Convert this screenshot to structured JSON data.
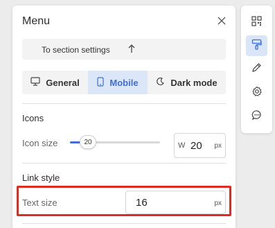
{
  "panel": {
    "title": "Menu",
    "close_icon": "close-icon",
    "section_link": {
      "label": "To section settings",
      "icon": "arrow-up-icon"
    },
    "tabs": [
      {
        "label": "General",
        "icon": "monitor-icon",
        "active": false
      },
      {
        "label": "Mobile",
        "icon": "phone-icon",
        "active": true
      },
      {
        "label": "Dark mode",
        "icon": "moon-icon",
        "active": false
      }
    ],
    "icons_section": {
      "title": "Icons",
      "icon_size": {
        "label": "Icon size",
        "slider_value": "20",
        "input_prefix": "W",
        "input_value": "20",
        "unit": "px"
      }
    },
    "link_style_section": {
      "title": "Link style",
      "text_size": {
        "label": "Text size",
        "value": "16",
        "unit": "px"
      }
    }
  },
  "toolbar": {
    "tools": [
      {
        "icon": "qr-code-icon",
        "active": false
      },
      {
        "icon": "paint-roller-icon",
        "active": true
      },
      {
        "icon": "pencil-icon",
        "active": false
      },
      {
        "icon": "gear-icon",
        "active": false
      },
      {
        "icon": "chat-bubble-icon",
        "active": false
      }
    ]
  },
  "colors": {
    "accent": "#3f6fd6",
    "active_tab_bg": "#dbe6f9",
    "highlight_border": "#e12b1f",
    "page_bg": "#ececec"
  }
}
